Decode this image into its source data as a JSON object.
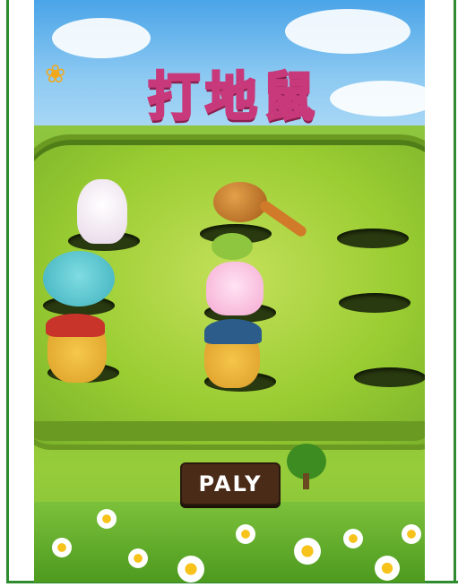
{
  "game": {
    "title_chars": [
      "打",
      "地",
      "鼠"
    ],
    "play_label": "PALY"
  },
  "colors": {
    "border": "#2e8b2e",
    "title_fill": "#f6d23a",
    "title_stroke": "#c7397a",
    "button_bg": "#4a2b18",
    "board_green": "#9acd32"
  },
  "characters": [
    "rabbit",
    "mouse",
    "pirate-cat",
    "pink-cat",
    "miner-cat"
  ],
  "icons": [
    "hammer-icon",
    "butterfly-icon",
    "leaf-icon",
    "flower-icon"
  ]
}
